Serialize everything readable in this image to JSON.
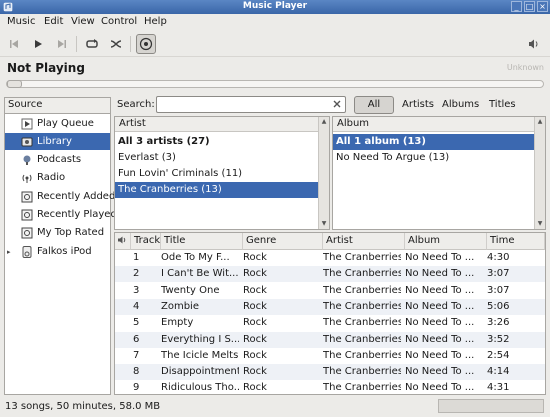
{
  "window": {
    "title": "Music Player",
    "controls": [
      "_",
      "□",
      "×"
    ]
  },
  "menu": [
    "Music",
    "Edit",
    "View",
    "Control",
    "Help"
  ],
  "now_playing": {
    "title": "Not Playing",
    "artist_placeholder": "Unknown",
    "seek_fraction": 0
  },
  "sources": {
    "header": "Source",
    "items": [
      {
        "label": "Play Queue",
        "icon": "play-queue-icon"
      },
      {
        "label": "Library",
        "icon": "library-icon",
        "selected": true
      },
      {
        "label": "Podcasts",
        "icon": "podcast-icon"
      },
      {
        "label": "Radio",
        "icon": "radio-icon"
      },
      {
        "label": "Recently Added",
        "icon": "playlist-icon"
      },
      {
        "label": "Recently Played",
        "icon": "playlist-icon"
      },
      {
        "label": "My Top Rated",
        "icon": "playlist-icon"
      },
      {
        "label": "Falkos iPod",
        "icon": "ipod-icon"
      }
    ]
  },
  "search": {
    "label": "Search:",
    "value": ""
  },
  "filters": {
    "all": "All",
    "artists": "Artists",
    "albums": "Albums",
    "titles": "Titles"
  },
  "artist_pane": {
    "header": "Artist",
    "rows": [
      "All 3 artists (27)",
      "Everlast (3)",
      "Fun Lovin' Criminals (11)",
      "The Cranberries (13)"
    ],
    "selected": 3
  },
  "album_pane": {
    "header": "Album",
    "rows": [
      "All 1 album (13)",
      "No Need To Argue (13)"
    ],
    "selected": 0
  },
  "tracks": {
    "columns": [
      "Track",
      "Title",
      "Genre",
      "Artist",
      "Album",
      "Time"
    ],
    "rows": [
      [
        "1",
        "Ode To My F...",
        "Rock",
        "The Cranberries",
        "No Need To ...",
        "4:30"
      ],
      [
        "2",
        "I Can't Be Wit...",
        "Rock",
        "The Cranberries",
        "No Need To ...",
        "3:07"
      ],
      [
        "3",
        "Twenty One",
        "Rock",
        "The Cranberries",
        "No Need To ...",
        "3:07"
      ],
      [
        "4",
        "Zombie",
        "Rock",
        "The Cranberries",
        "No Need To ...",
        "5:06"
      ],
      [
        "5",
        "Empty",
        "Rock",
        "The Cranberries",
        "No Need To ...",
        "3:26"
      ],
      [
        "6",
        "Everything I S...",
        "Rock",
        "The Cranberries",
        "No Need To ...",
        "3:52"
      ],
      [
        "7",
        "The Icicle Melts",
        "Rock",
        "The Cranberries",
        "No Need To ...",
        "2:54"
      ],
      [
        "8",
        "Disappointment",
        "Rock",
        "The Cranberries",
        "No Need To ...",
        "4:14"
      ],
      [
        "9",
        "Ridiculous Tho...",
        "Rock",
        "The Cranberries",
        "No Need To ...",
        "4:31"
      ]
    ]
  },
  "status": {
    "text": "13 songs, 50 minutes, 58.0 MB"
  },
  "colors": {
    "selection": "#3b68b0",
    "titlebar": "#4a76b8"
  }
}
